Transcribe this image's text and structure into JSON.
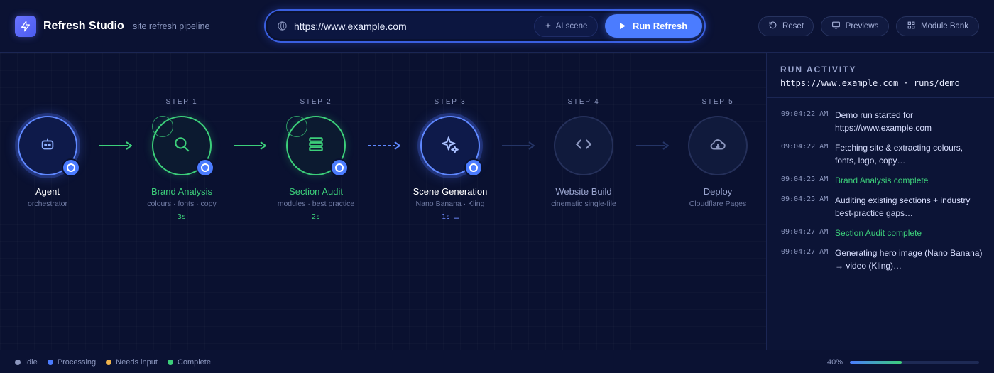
{
  "header": {
    "title": "Refresh Studio",
    "subtitle": "site refresh pipeline",
    "url_value": "https://www.example.com",
    "ai_scene_label": "AI scene",
    "run_label": "Run Refresh",
    "reset_label": "Reset",
    "previews_label": "Previews",
    "module_bank_label": "Module Bank"
  },
  "pipeline": {
    "agent": {
      "title": "Agent",
      "sub": "orchestrator",
      "icon": "robot-icon"
    },
    "steps": [
      {
        "step": "STEP 1",
        "title": "Brand Analysis",
        "sub": "colours · fonts · copy",
        "time": "3s",
        "status": "complete",
        "icon": "search-icon"
      },
      {
        "step": "STEP 2",
        "title": "Section Audit",
        "sub": "modules · best practice",
        "time": "2s",
        "status": "complete",
        "icon": "sections-icon"
      },
      {
        "step": "STEP 3",
        "title": "Scene Generation",
        "sub": "Nano Banana · Kling",
        "time": "1s …",
        "status": "processing",
        "icon": "sparkles-icon"
      },
      {
        "step": "STEP 4",
        "title": "Website Build",
        "sub": "cinematic single-file",
        "time": "",
        "status": "idle",
        "icon": "code-icon"
      },
      {
        "step": "STEP 5",
        "title": "Deploy",
        "sub": "Cloudflare Pages",
        "time": "",
        "status": "idle",
        "icon": "cloud-icon"
      }
    ]
  },
  "activity": {
    "title": "RUN ACTIVITY",
    "subtitle": "https://www.example.com · runs/demo",
    "log": [
      {
        "time": "09:04:22 AM",
        "msg": "Demo run started for https://www.example.com",
        "type": "info"
      },
      {
        "time": "09:04:22 AM",
        "msg": "Fetching site & extracting colours, fonts, logo, copy…",
        "type": "info"
      },
      {
        "time": "09:04:25 AM",
        "msg": "Brand Analysis complete",
        "type": "ok"
      },
      {
        "time": "09:04:25 AM",
        "msg": "Auditing existing sections + industry best-practice gaps…",
        "type": "info"
      },
      {
        "time": "09:04:27 AM",
        "msg": "Section Audit complete",
        "type": "ok"
      },
      {
        "time": "09:04:27 AM",
        "msg": "Generating hero image (Nano Banana) → video (Kling)…",
        "type": "info"
      }
    ]
  },
  "footer": {
    "legend": [
      {
        "label": "Idle",
        "color": "#8d98c0"
      },
      {
        "label": "Processing",
        "color": "#4b7cff"
      },
      {
        "label": "Needs input",
        "color": "#f0b44c"
      },
      {
        "label": "Complete",
        "color": "#3ccf7a"
      }
    ],
    "progress_label": "40%",
    "progress_value": 0.4
  },
  "colors": {
    "accent": "#4b7cff",
    "complete": "#3ccf7a",
    "background": "#0a1130"
  }
}
